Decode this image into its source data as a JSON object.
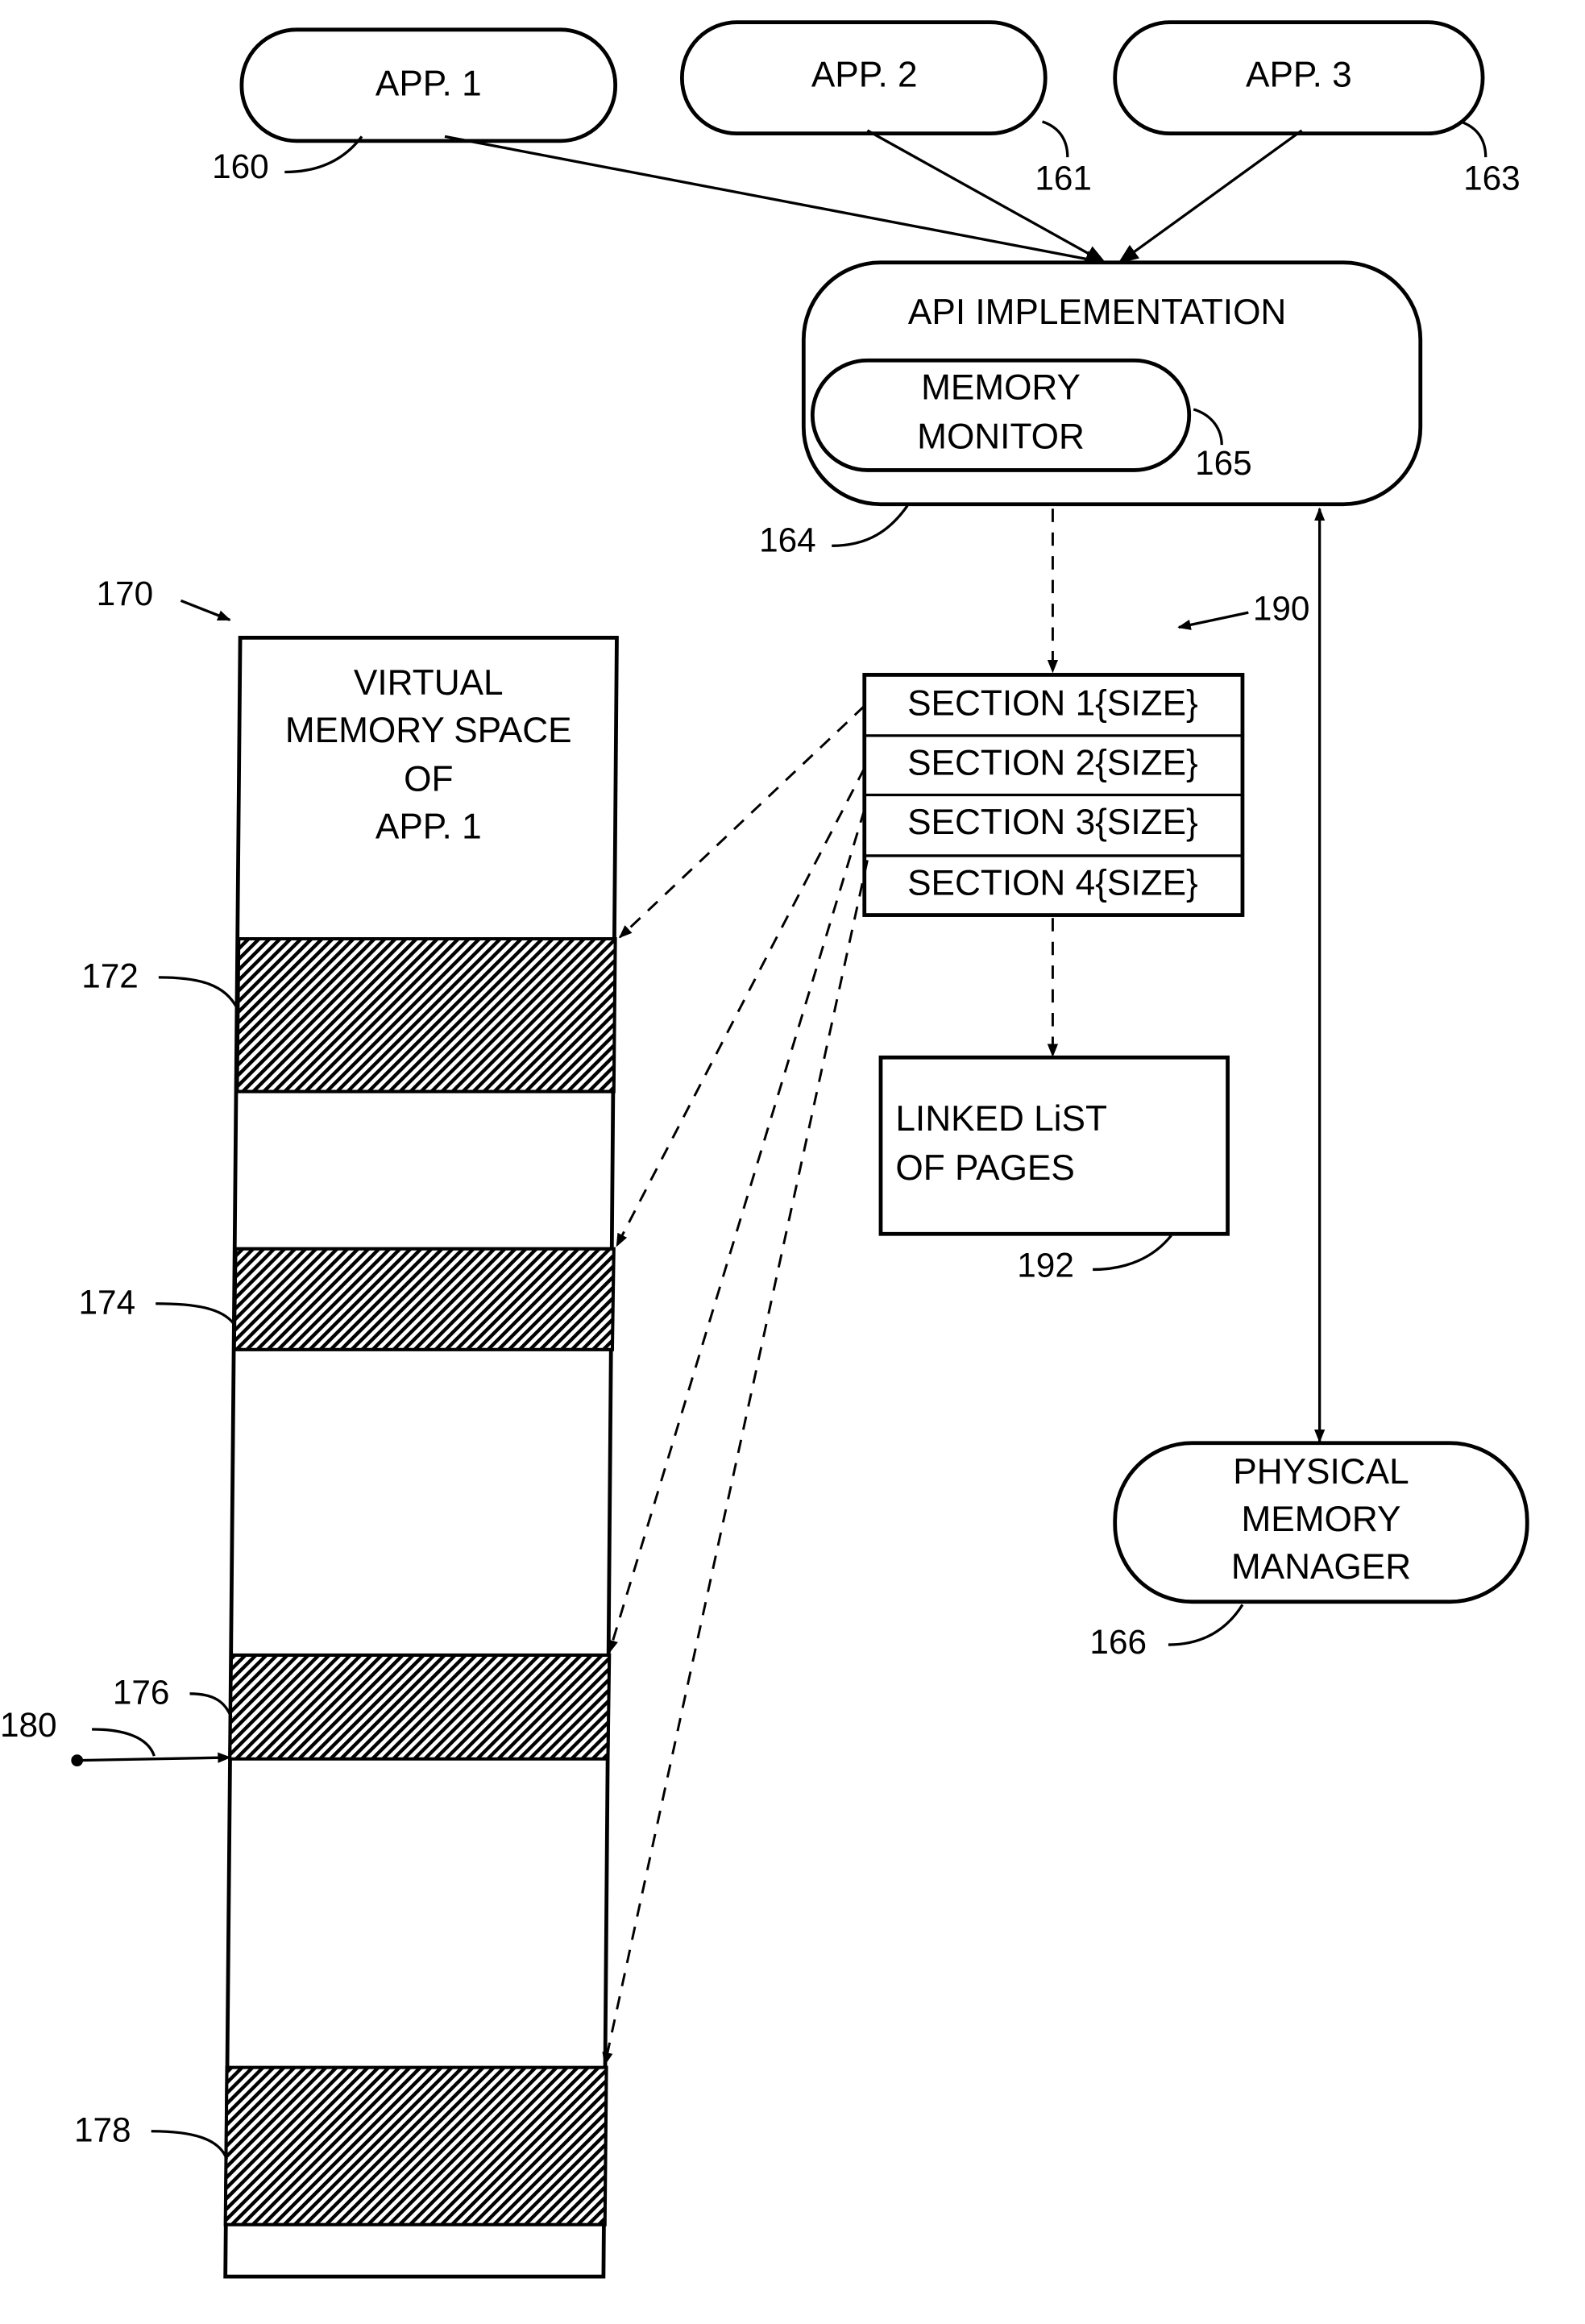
{
  "diagram": {
    "apps": [
      {
        "label": "APP. 1",
        "ref": "160"
      },
      {
        "label": "APP. 2",
        "ref": "161"
      },
      {
        "label": "APP. 3",
        "ref": "163"
      }
    ],
    "api_implementation": {
      "label": "API IMPLEMENTATION",
      "ref": "164"
    },
    "memory_monitor": {
      "line1": "MEMORY",
      "line2": "MONITOR",
      "ref": "165"
    },
    "physical_memory_manager": {
      "line1": "PHYSICAL",
      "line2": "MEMORY",
      "line3": "MANAGER",
      "ref": "166"
    },
    "sections": {
      "ref": "190",
      "rows": [
        "SECTION 1{SIZE}",
        "SECTION 2{SIZE}",
        "SECTION 3{SIZE}",
        "SECTION 4{SIZE}"
      ]
    },
    "linked_list": {
      "line1": "LINKED LiST",
      "line2": "OF PAGES",
      "ref": "192"
    },
    "virtual_memory": {
      "ref": "170",
      "line1": "VIRTUAL",
      "line2": "MEMORY SPACE",
      "line3": "OF",
      "line4": "APP. 1",
      "regions": [
        "172",
        "174",
        "176",
        "178"
      ],
      "pointer_ref": "180"
    }
  }
}
